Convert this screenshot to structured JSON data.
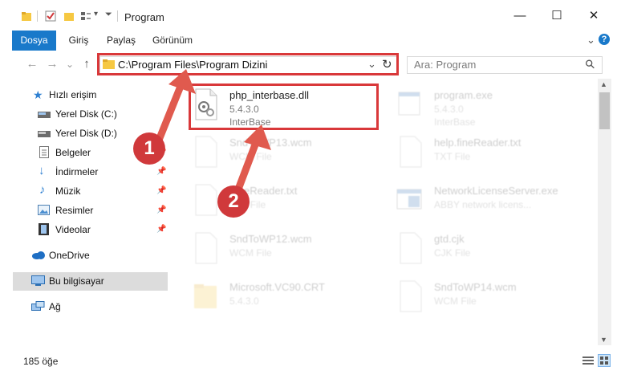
{
  "window": {
    "title": "Program",
    "controls": {
      "minimize": "—",
      "maximize": "☐",
      "close": "✕"
    }
  },
  "ribbon": {
    "tabs": [
      "Dosya",
      "Giriş",
      "Paylaş",
      "Görünüm"
    ],
    "expand_icon": "⌄",
    "help_icon": "?"
  },
  "nav": {
    "back": "←",
    "forward": "→",
    "recent": "⌄",
    "up": "↑",
    "address": "C:\\Program Files\\Program Dizini",
    "address_dropdown": "⌄",
    "refresh": "↻",
    "search_placeholder": "Ara: Program",
    "search_icon": "⚲"
  },
  "sidebar": {
    "items": [
      {
        "label": "Hızlı erişim",
        "icon": "star-icon",
        "color": "#2d7fd1"
      },
      {
        "label": "Yerel Disk (C:)",
        "icon": "drive-icon",
        "pinned": true
      },
      {
        "label": "Yerel Disk (D:)",
        "icon": "drive-icon",
        "pinned": true
      },
      {
        "label": "Belgeler",
        "icon": "document-icon",
        "pinned": true
      },
      {
        "label": "İndirmeler",
        "icon": "download-icon",
        "pinned": true
      },
      {
        "label": "Müzik",
        "icon": "music-icon",
        "pinned": true
      },
      {
        "label": "Resimler",
        "icon": "pictures-icon",
        "pinned": true
      },
      {
        "label": "Videolar",
        "icon": "video-icon",
        "pinned": true
      },
      {
        "label": "OneDrive",
        "icon": "cloud-icon"
      },
      {
        "label": "Bu bilgisayar",
        "icon": "computer-icon",
        "selected": true
      },
      {
        "label": "Ağ",
        "icon": "network-icon"
      }
    ],
    "pin_glyph": "📌"
  },
  "files": [
    {
      "name": "php_interbase.dll",
      "line1": "5.4.3.0",
      "line2": "InterBase",
      "highlight": true
    },
    {
      "name": "program.exe",
      "line1": "5.4.3.0",
      "line2": "InterBase"
    },
    {
      "name": "SndToWP13.wcm",
      "line1": "WCM File",
      "line2": ""
    },
    {
      "name": "help.fineReader.txt",
      "line1": "TXT File",
      "line2": ""
    },
    {
      "name": "FineReader.txt",
      "line1": "TXT File",
      "line2": ""
    },
    {
      "name": "NetworkLicenseServer.exe",
      "line1": "ABBY network licens...",
      "line2": ""
    },
    {
      "name": "SndToWP12.wcm",
      "line1": "WCM File",
      "line2": ""
    },
    {
      "name": "gtd.cjk",
      "line1": "CJK File",
      "line2": ""
    },
    {
      "name": "Microsoft.VC90.CRT",
      "line1": "5.4.3.0",
      "line2": ""
    },
    {
      "name": "SndToWP14.wcm",
      "line1": "WCM File",
      "line2": ""
    }
  ],
  "annotations": {
    "badge1": "1",
    "badge2": "2",
    "color": "#d9383a"
  },
  "status": {
    "count": "185 öğe"
  },
  "colors": {
    "accent": "#1979ca",
    "selection": "#dcdcdc",
    "arrow": "#e05a4e"
  }
}
